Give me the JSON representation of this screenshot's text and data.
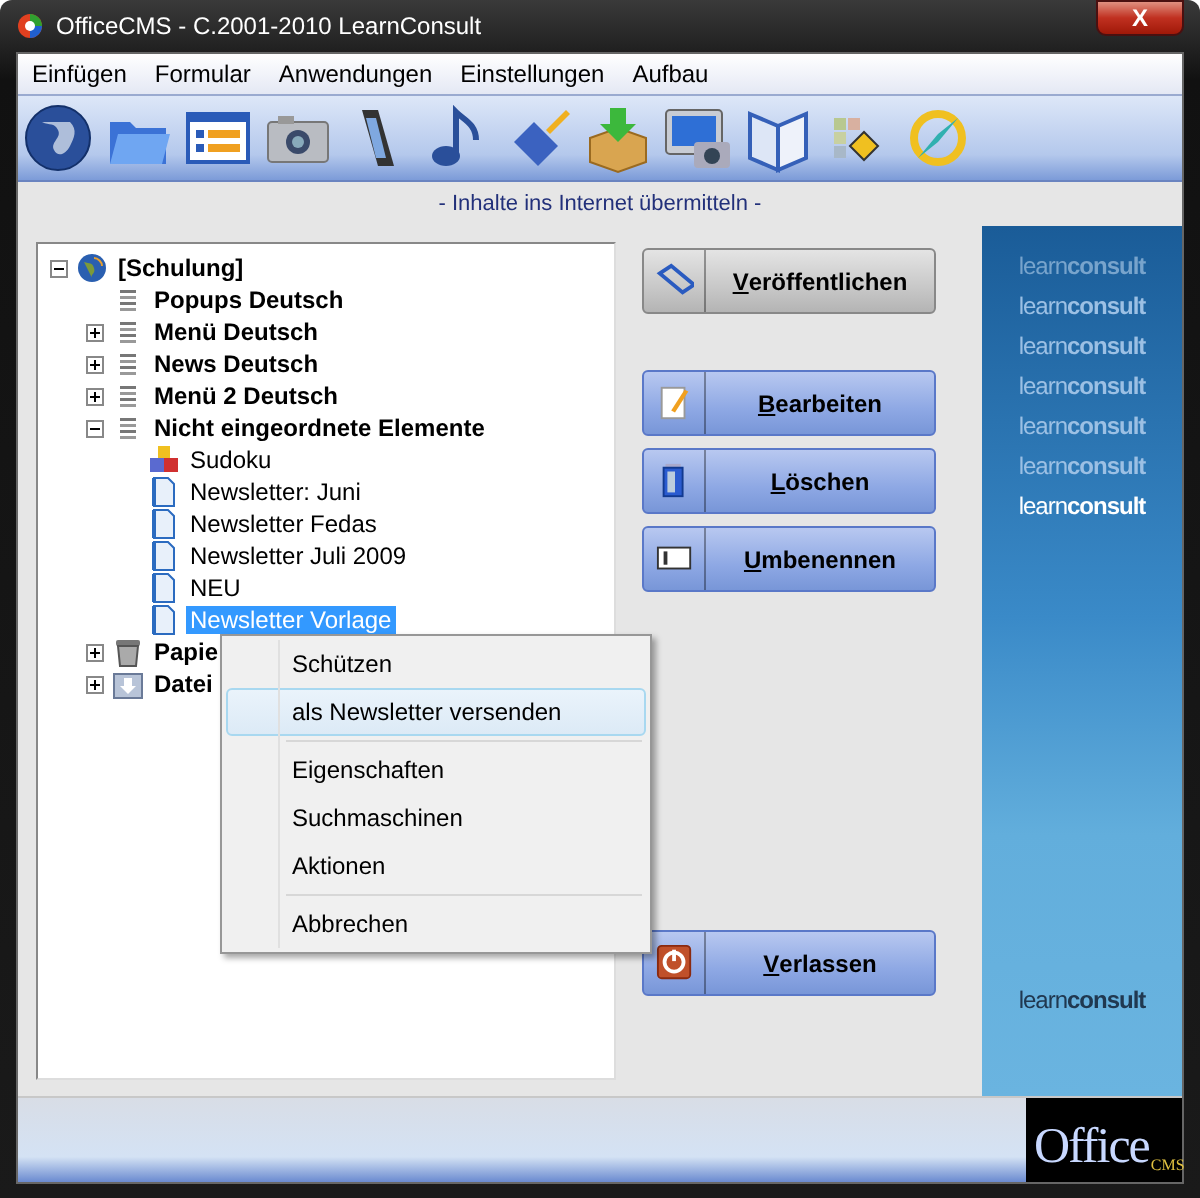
{
  "window": {
    "title": "OfficeCMS - C.2001-2010 LearnConsult",
    "close": "X"
  },
  "menu_bar": [
    "Einfügen",
    "Formular",
    "Anwendungen",
    "Einstellungen",
    "Aufbau"
  ],
  "subtitle": "- Inhalte ins Internet übermitteln -",
  "tree": [
    {
      "label": "[Schulung]",
      "kind": "globe",
      "expanded": true,
      "selected": false,
      "children": [
        {
          "label": "Popups Deutsch",
          "kind": "page",
          "selected": false
        },
        {
          "label": "Menü Deutsch",
          "kind": "page",
          "expanded": false,
          "selected": false
        },
        {
          "label": "News Deutsch",
          "kind": "page",
          "expanded": false,
          "selected": false
        },
        {
          "label": "Menü 2 Deutsch",
          "kind": "page",
          "expanded": false,
          "selected": false
        },
        {
          "label": "Nicht eingeordnete Elemente",
          "kind": "page",
          "expanded": true,
          "selected": false,
          "children": [
            {
              "label": "Sudoku",
              "kind": "blocks",
              "selected": false
            },
            {
              "label": "Newsletter: Juni",
              "kind": "doc",
              "selected": false
            },
            {
              "label": "Newsletter Fedas",
              "kind": "doc",
              "selected": false
            },
            {
              "label": "Newsletter Juli 2009",
              "kind": "doc",
              "selected": false
            },
            {
              "label": "NEU",
              "kind": "doc",
              "selected": false
            },
            {
              "label": "Newsletter Vorlage",
              "kind": "doc",
              "selected": true
            }
          ]
        },
        {
          "label": "Papie",
          "kind": "trash",
          "expanded": false,
          "selected": false
        },
        {
          "label": "Datei",
          "kind": "download",
          "expanded": false,
          "selected": false
        }
      ]
    }
  ],
  "context_menu": [
    {
      "kind": "item",
      "label": "Schützen",
      "selected": false
    },
    {
      "kind": "item",
      "label": "als Newsletter versenden",
      "selected": true
    },
    {
      "kind": "separator"
    },
    {
      "kind": "item",
      "label": "Eigenschaften",
      "selected": false
    },
    {
      "kind": "item",
      "label": "Suchmaschinen",
      "selected": false
    },
    {
      "kind": "item",
      "label": "Aktionen",
      "selected": false
    },
    {
      "kind": "separator"
    },
    {
      "kind": "item",
      "label": "Abbrechen",
      "selected": false
    }
  ],
  "buttons": [
    {
      "label": "Veröffentlichen",
      "kind": "grey"
    },
    {
      "label": "Bearbeiten",
      "kind": "blue"
    },
    {
      "label": "Löschen",
      "kind": "blue"
    },
    {
      "label": "Umbenennen",
      "kind": "blue"
    },
    {
      "label": "Verlassen",
      "kind": "blue"
    }
  ],
  "banner": {
    "logos": [
      {
        "text": "learn**consult**",
        "kind": "faint"
      },
      {
        "text": "learn**consult**",
        "kind": "faded"
      },
      {
        "text": "learn**consult**",
        "kind": "faded"
      },
      {
        "text": "learn**consult**",
        "kind": "faded"
      },
      {
        "text": "learn**consult**",
        "kind": "faded"
      },
      {
        "text": "learn**consult**",
        "kind": "faded"
      },
      {
        "text": "learn**consult**",
        "kind": "bright"
      }
    ],
    "footer_logo": {
      "text": "learn**consult**",
      "kind": "dark"
    }
  },
  "status_bar": {
    "logo": {
      "name": "Office",
      "sub": "CMS"
    }
  }
}
